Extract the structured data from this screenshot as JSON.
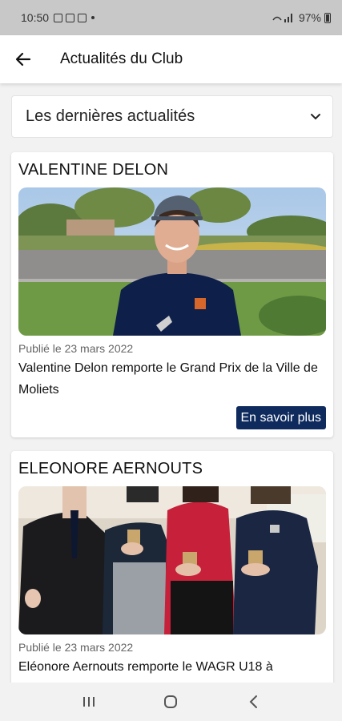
{
  "status_bar": {
    "time": "10:50",
    "battery": "97%"
  },
  "app_bar": {
    "title": "Actualités du Club"
  },
  "dropdown": {
    "selected": "Les dernières actualités"
  },
  "articles": [
    {
      "heading": "VALENTINE DELON",
      "date": "Publié le 23 mars 2022",
      "summary": "Valentine Delon remporte le Grand Prix de la Ville de Moliets",
      "button_label": "En savoir plus"
    },
    {
      "heading": "ELEONORE AERNOUTS",
      "date": "Publié le 23 mars 2022",
      "summary": "Eléonore Aernouts remporte le WAGR U18 à"
    }
  ],
  "colors": {
    "primary_button": "#0f2b5e",
    "status_bar_bg": "#c8c8c8"
  },
  "icons": {
    "back": "arrow-left-icon",
    "dropdown": "chevron-down-icon",
    "nav_recents": "recents-icon",
    "nav_home": "home-icon",
    "nav_back": "nav-back-icon"
  }
}
